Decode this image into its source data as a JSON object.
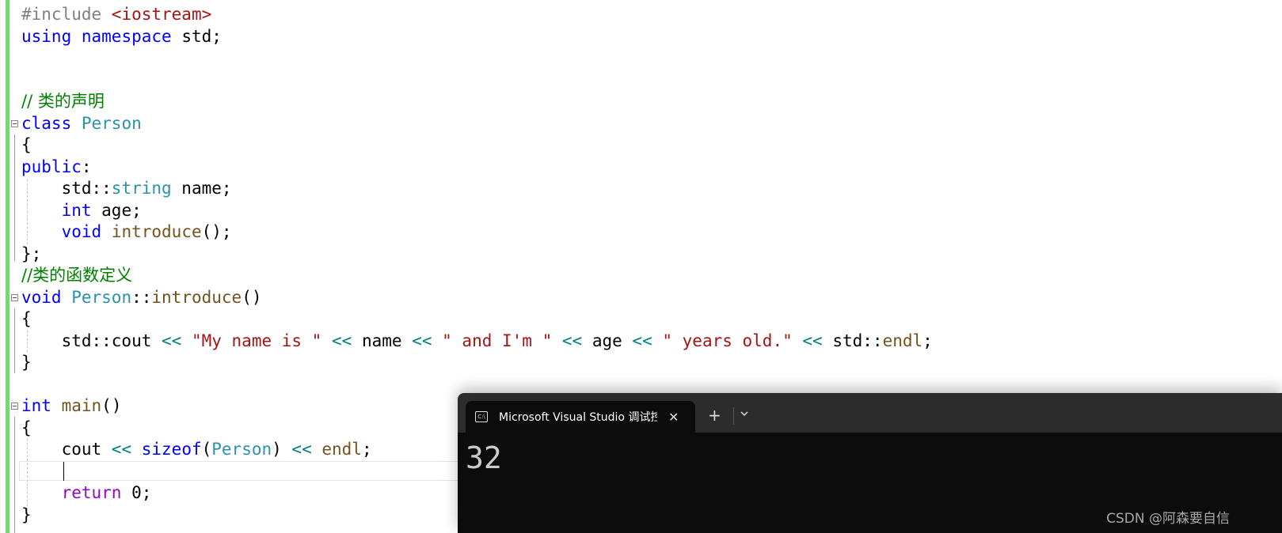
{
  "editor": {
    "lines": {
      "l1": {
        "pp": "#include ",
        "inc": "<iostream>"
      },
      "l2": {
        "kw1": "using",
        "kw2": "namespace",
        "rest": " std;"
      },
      "l5": {
        "comment": "// 类的声明"
      },
      "l6": {
        "kw": "class",
        "type": "Person"
      },
      "l7": {
        "text": "{"
      },
      "l8": {
        "kw": "public",
        "rest": ":"
      },
      "l9": {
        "pre": "    std::",
        "type": "string",
        "rest": " name;"
      },
      "l10": {
        "pre": "    ",
        "kw": "int",
        "rest": " age;"
      },
      "l11": {
        "pre": "    ",
        "kw": "void",
        "fn": "introduce",
        "rest": "();"
      },
      "l12": {
        "text": "};"
      },
      "l13": {
        "comment": "//类的函数定义"
      },
      "l14": {
        "kw": "void",
        "type": "Person",
        "sep": "::",
        "fn": "introduce",
        "rest": "()"
      },
      "l15": {
        "text": "{"
      },
      "l16": {
        "pre": "    std::cout ",
        "op": "<<",
        "s1": "\"My name is \"",
        "v1": "name",
        "s2": "\" and I'm \"",
        "v2": "age",
        "s3": "\" years old.\"",
        "v3": "std::",
        "fn": "endl",
        "end": ";"
      },
      "l17": {
        "text": "}"
      },
      "l19": {
        "kw": "int",
        "fn": "main",
        "rest": "()"
      },
      "l20": {
        "text": "{"
      },
      "l21": {
        "pre": "    cout ",
        "op": "<<",
        "kw": "sizeof",
        "type": "Person",
        "fn": "endl",
        "end": ";"
      },
      "l23": {
        "pre": "    ",
        "kw": "return",
        "rest": " 0;"
      },
      "l24": {
        "text": "}"
      }
    }
  },
  "terminal": {
    "tab_title": "Microsoft Visual Studio 调试控制台",
    "tab_icon": "console-icon",
    "close_label": "✕",
    "new_tab_label": "+",
    "output": "32"
  },
  "watermark": "CSDN @阿森要自信"
}
